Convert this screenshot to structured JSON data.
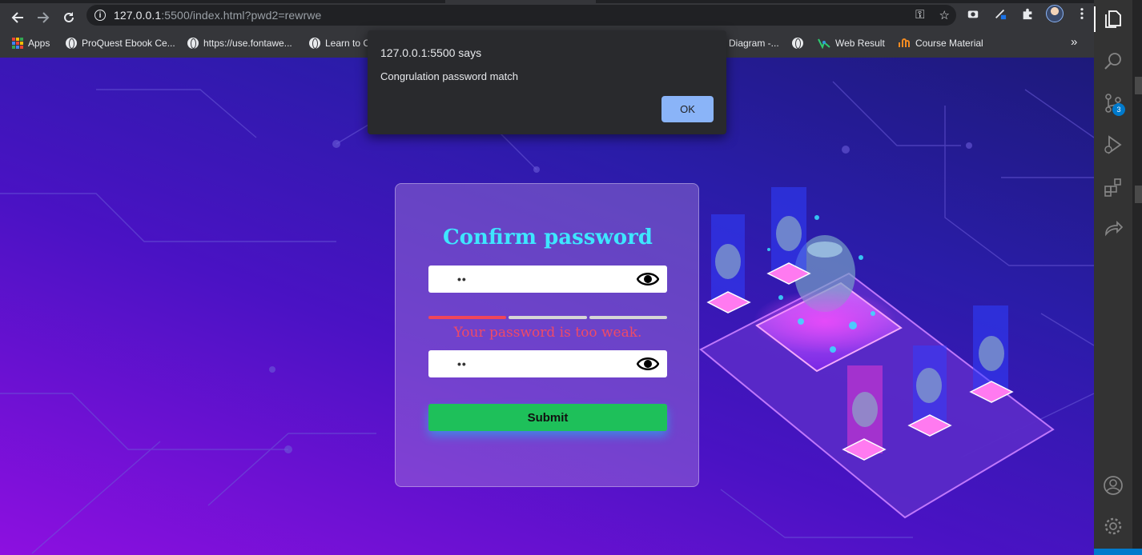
{
  "browser": {
    "url_host": "127.0.0.1",
    "url_rest": ":5500/index.html?pwd2=rewrwe",
    "bookmarks": [
      {
        "label": "Apps"
      },
      {
        "label": "ProQuest Ebook Ce..."
      },
      {
        "label": "https://use.fontawe..."
      },
      {
        "label": "Learn to C"
      },
      {
        "label": "Diagram -..."
      },
      {
        "label": ""
      },
      {
        "label": "Web Result"
      },
      {
        "label": "Course Material"
      }
    ],
    "overflow": "»"
  },
  "dialog": {
    "title": "127.0.0.1:5500 says",
    "message": "Congrulation password match",
    "ok_label": "OK"
  },
  "form": {
    "heading": "Confirm password",
    "password_value": "••",
    "confirm_value": "••",
    "strength_segments": [
      true,
      false,
      false
    ],
    "strength_message": "Your password is too weak.",
    "submit_label": "Submit"
  },
  "vscode": {
    "scm_badge": "3"
  }
}
